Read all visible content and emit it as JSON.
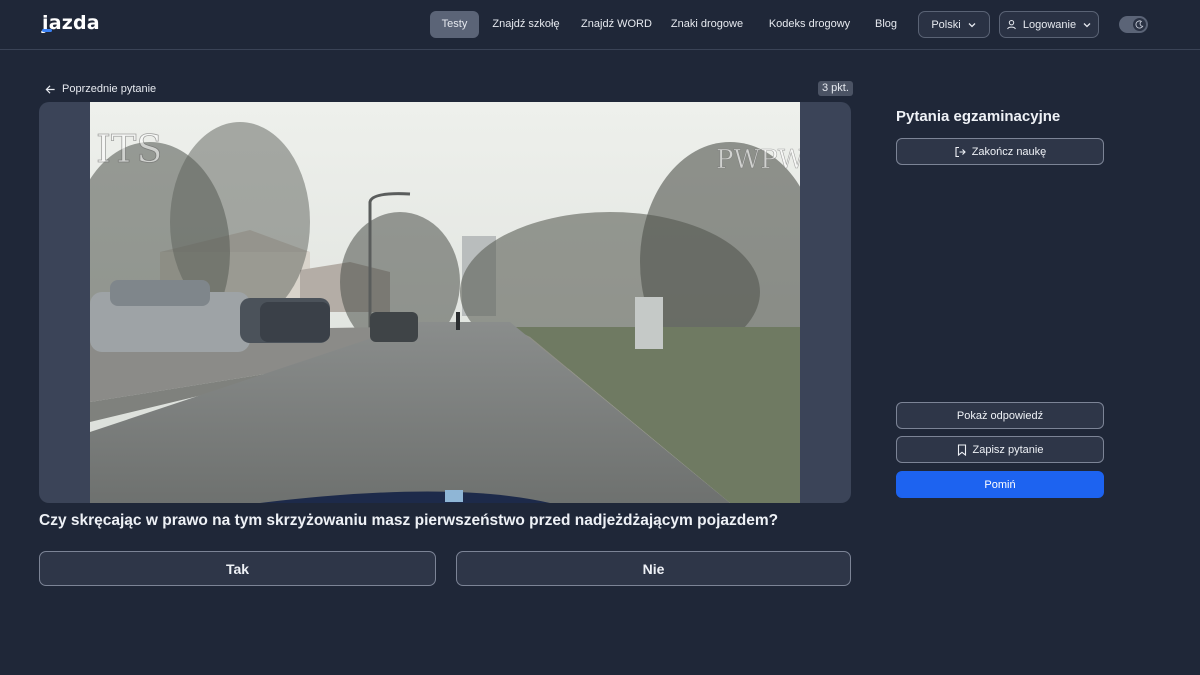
{
  "header": {
    "logo": "jazda",
    "nav": [
      {
        "label": "Testy",
        "active": true
      },
      {
        "label": "Znajdź szkołę"
      },
      {
        "label": "Znajdź WORD"
      },
      {
        "label": "Znaki drogowe"
      },
      {
        "label": "Kodeks drogowy"
      },
      {
        "label": "Blog"
      }
    ],
    "language": "Polski",
    "login": "Logowanie",
    "theme_icon": "moon-icon"
  },
  "question": {
    "back_label": "Poprzednie pytanie",
    "points": "3 pkt.",
    "text": "Czy skręcając w prawo na tym skrzyżowaniu masz pierwszeństwo przed nadjeżdżającym pojazdem?",
    "answers": [
      "Tak",
      "Nie"
    ],
    "media_watermarks": [
      "ITS",
      "PWPW"
    ]
  },
  "sidebar": {
    "title": "Pytania egzaminacyjne",
    "finish_label": "Zakończ naukę",
    "show_answer_label": "Pokaż odpowiedź",
    "save_label": "Zapisz pytanie",
    "skip_label": "Pomiń"
  },
  "colors": {
    "background": "#1f2738",
    "accent": "#1d63f0",
    "active_nav": "#5b6477"
  }
}
